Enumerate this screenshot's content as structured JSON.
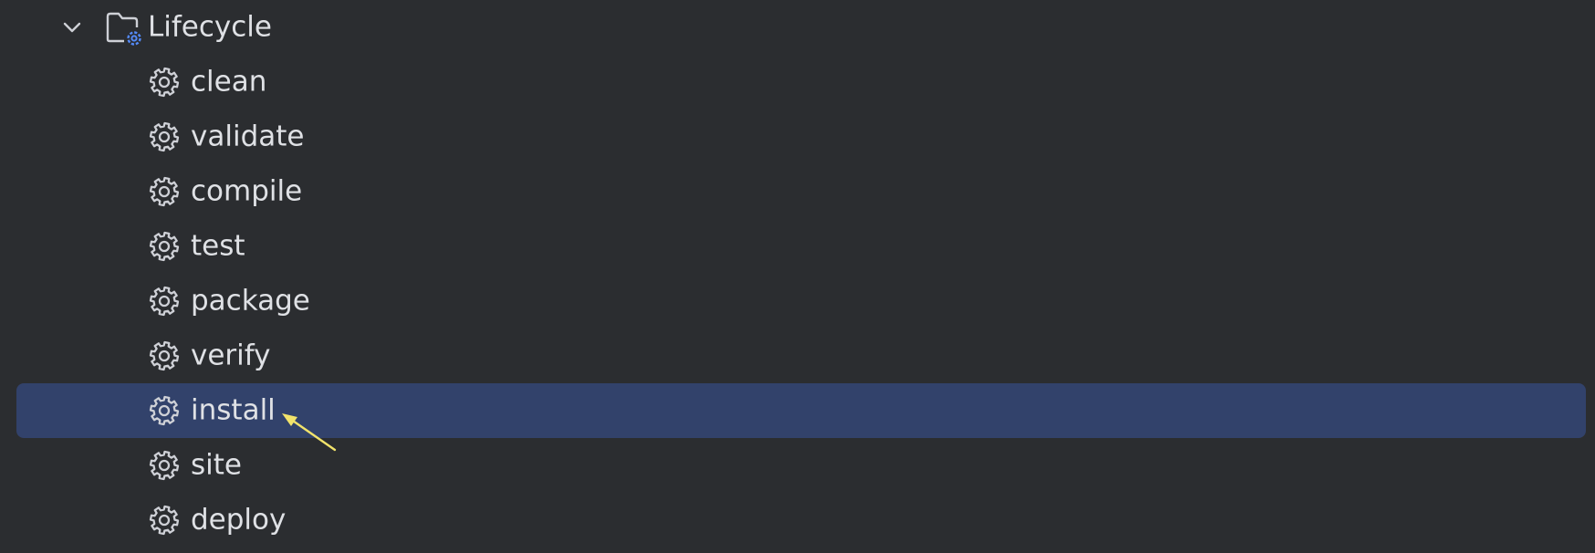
{
  "tree": {
    "group": {
      "label": "Lifecycle",
      "icon": "folder-gear-icon",
      "expanded": true
    },
    "items": [
      {
        "label": "clean",
        "icon": "gear-icon"
      },
      {
        "label": "validate",
        "icon": "gear-icon"
      },
      {
        "label": "compile",
        "icon": "gear-icon"
      },
      {
        "label": "test",
        "icon": "gear-icon"
      },
      {
        "label": "package",
        "icon": "gear-icon"
      },
      {
        "label": "verify",
        "icon": "gear-icon"
      },
      {
        "label": "install",
        "icon": "gear-icon",
        "selected": true
      },
      {
        "label": "site",
        "icon": "gear-icon"
      },
      {
        "label": "deploy",
        "icon": "gear-icon"
      }
    ]
  },
  "colors": {
    "background": "#2b2d30",
    "selection": "#32426b",
    "text": "#dfe1e5",
    "icon_stroke": "#ced0d6",
    "folder_gear_accent": "#548af7",
    "annotation_arrow": "#f2e36b"
  }
}
